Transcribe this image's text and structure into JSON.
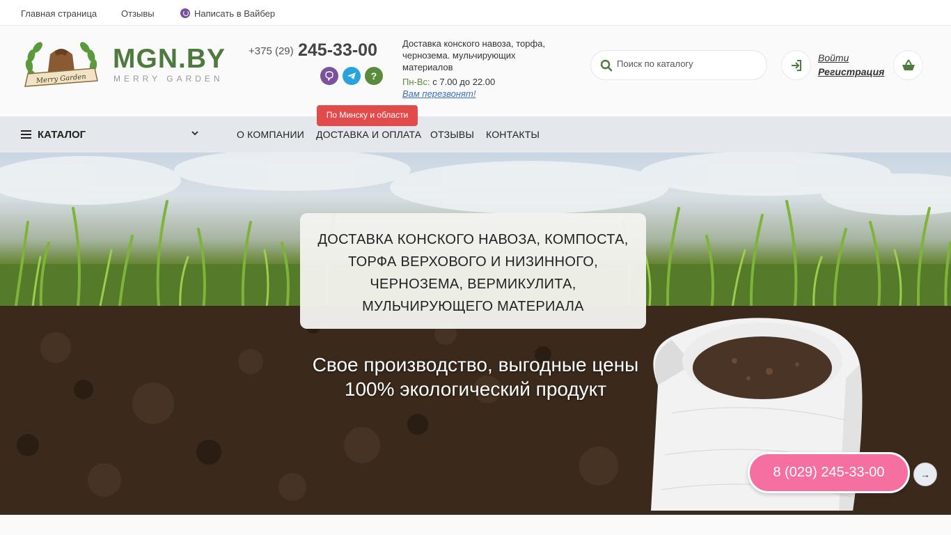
{
  "topbar": {
    "home": "Главная страница",
    "reviews": "Отзывы",
    "viber": "Написать в Вайбер"
  },
  "header": {
    "brand": "MGN.BY",
    "brand_sub": "MERRY GARDEN",
    "logo_ribbon": "Merry Garden",
    "phone_prefix": "+375 (29)",
    "phone_main": "245-33-00",
    "delivery_text": "Доставка конского навоза, торфа, чернозема. мульчирующих материалов",
    "hours_label": "Пн-Вс:",
    "hours_value": "с 7.00 до 22.00",
    "callback": "Вам перезвонят!",
    "search_placeholder": "Поиск по каталогу",
    "login": "Войти",
    "register": "Регистрация",
    "messenger_icons": [
      "viber-icon",
      "telegram-icon",
      "question-icon"
    ]
  },
  "nav": {
    "catalog": "КАТАЛОГ",
    "tooltip": "По Минску и области",
    "links": [
      "О КОМПАНИИ",
      "ДОСТАВКА И ОПЛАТА",
      "ОТЗЫВЫ",
      "КОНТАКТЫ"
    ]
  },
  "hero": {
    "title_lines": [
      "ДОСТАВКА КОНСКОГО НАВОЗА, КОМПОСТА,",
      "ТОРФА ВЕРХОВОГО И НИЗИННОГО,",
      "ЧЕРНОЗЕМА, ВЕРМИКУЛИТА,",
      "МУЛЬЧИРУЮЩЕГО МАТЕРИАЛА"
    ],
    "subtitle_lines": [
      "Свое производство, выгодные цены",
      "100% экологический продукт"
    ]
  },
  "float": {
    "call": "8 (029) 245-33-00",
    "arrow": "→"
  },
  "colors": {
    "brand_green": "#4e7a3d",
    "tooltip_red": "#e24b4b",
    "call_pink": "#f56fa1",
    "viber": "#7b519d",
    "telegram": "#2aa3dd",
    "question": "#5a8a3c"
  }
}
